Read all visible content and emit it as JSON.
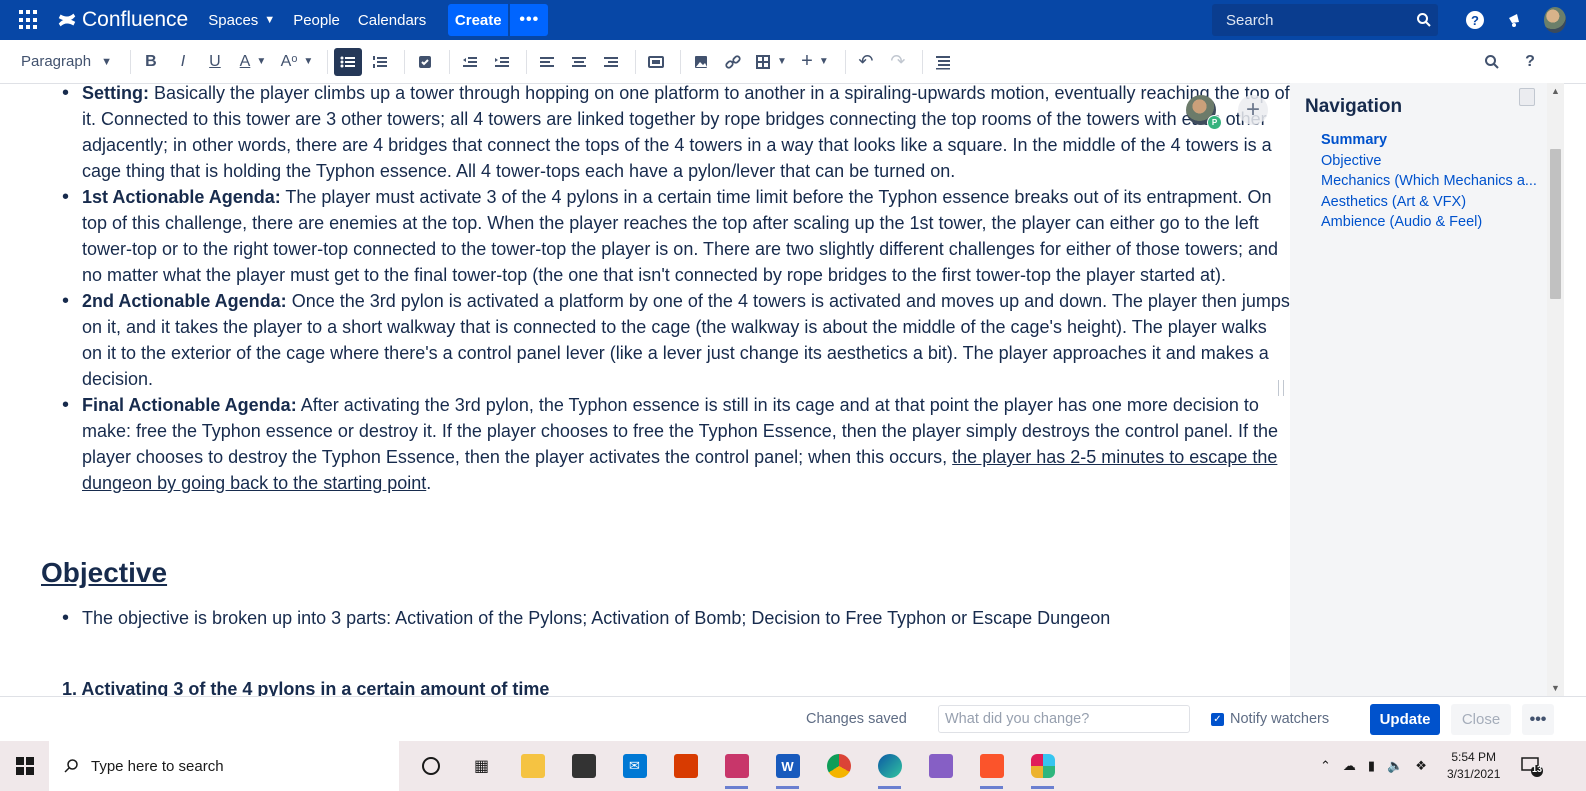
{
  "topnav": {
    "brand": "Confluence",
    "items": [
      {
        "label": "Spaces",
        "dropdown": true
      },
      {
        "label": "People"
      },
      {
        "label": "Calendars"
      }
    ],
    "create_label": "Create",
    "more_label": "•••",
    "search_placeholder": "Search"
  },
  "toolbar": {
    "paragraph_style": "Paragraph"
  },
  "content": {
    "bullets": [
      {
        "bold": "Setting:",
        "text": " Basically the player climbs up a tower through hopping on one platform to another in a spiraling-upwards motion, eventually reaching the top of it. Connected to this tower are 3 other towers; all 4 towers are linked together by rope bridges connecting the top rooms of the towers with each other adjacently; in other words, there are 4 bridges that connect the tops of the 4 towers in a way that looks like a square. In the middle of the 4 towers is a cage thing that is holding the Typhon essence. All 4 tower-tops each have a pylon/lever that can be turned on."
      },
      {
        "bold": "1st Actionable Agenda:",
        "text": " The player must activate 3 of the 4 pylons in a certain time limit before the Typhon essence breaks out of its entrapment. On top of this challenge, there are enemies at the top. When the player reaches the top after scaling up the 1st tower, the player can either go to the left tower-top or to the right tower-top connected to the tower-top the player is on. There are two slightly different challenges for either of those towers; and no matter what the player must get to the final tower-top (the one that isn't connected by rope bridges to the first tower-top the player started at)."
      },
      {
        "bold": "2nd Actionable Agenda:",
        "text": " Once the 3rd pylon is activated a platform by one of the 4 towers is activated and moves up and down. The player then jumps on it, and it takes the player to a short walkway that is connected to the cage (the walkway is about the middle of the cage's height). The player walks on it to the exterior of the cage where there's a control panel lever (like a lever just change its aesthetics a bit). The player approaches it and makes a decision."
      },
      {
        "bold": "Final Actionable Agenda:",
        "text": " After activating the 3rd pylon, the Typhon essence is still in its cage and at that point the player has one more decision to make: free the Typhon essence or destroy it. If the player chooses to free the Typhon Essence, then the player simply destroys the control panel. If the player chooses to destroy the Typhon Essence, then the player activates the control panel; when this occurs, ",
        "underlined": "the player has 2-5 minutes to escape the dungeon by going back to the starting point",
        "tail": "."
      }
    ],
    "objective_heading": "Objective",
    "objective_bullet": "The objective is broken up into 3 parts: Activation of the Pylons; Activation of Bomb; Decision to Free Typhon or Escape Dungeon",
    "numbered_item": "1. Activating 3 of the 4 pylons in a certain amount of time",
    "collaborator_badge": "P"
  },
  "navigation": {
    "title": "Navigation",
    "links": [
      {
        "label": "Summary",
        "active": true
      },
      {
        "label": "Objective"
      },
      {
        "label": "Mechanics (Which Mechanics a..."
      },
      {
        "label": "Aesthetics (Art & VFX)"
      },
      {
        "label": "Ambience (Audio & Feel)"
      }
    ]
  },
  "bottombar": {
    "status": "Changes saved",
    "change_placeholder": "What did you change?",
    "notify_label": "Notify watchers",
    "notify_checked": true,
    "update_label": "Update",
    "close_label": "Close",
    "more_label": "•••"
  },
  "taskbar": {
    "search_placeholder": "Type here to search",
    "time": "5:54 PM",
    "date": "3/31/2021",
    "notification_count": "13"
  },
  "colors": {
    "nav_bg": "#0747a6",
    "primary": "#0052cc",
    "create_bg": "#0065ff",
    "text": "#172b4d"
  }
}
